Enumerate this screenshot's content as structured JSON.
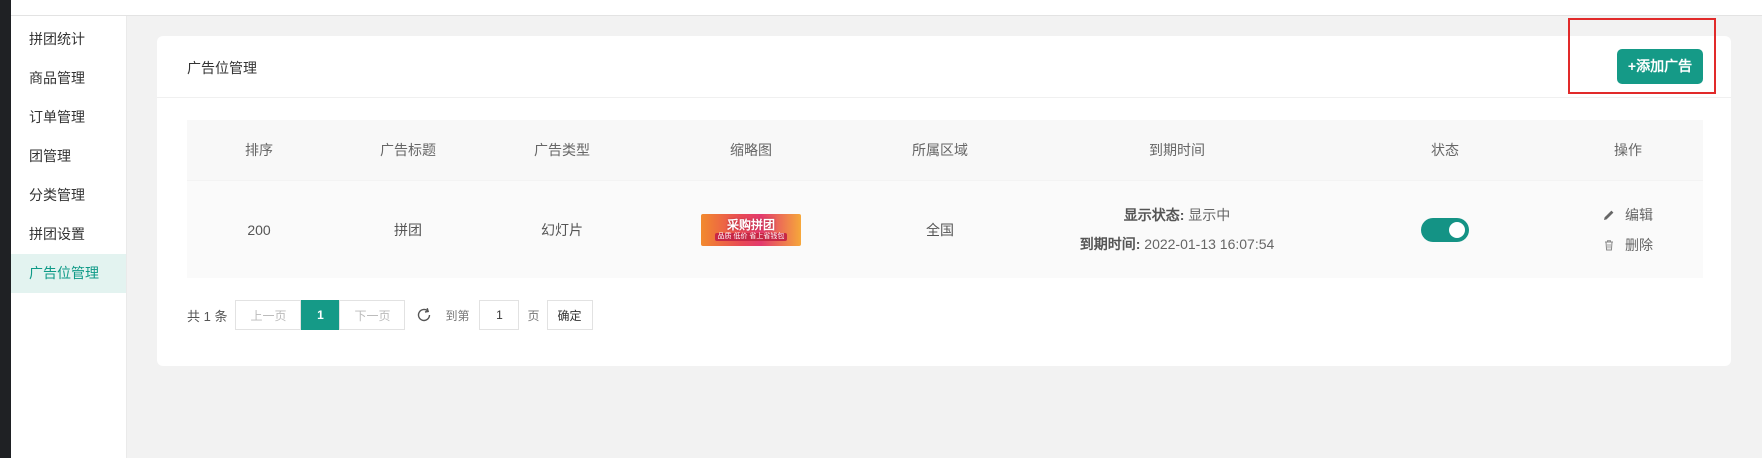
{
  "sidebar": {
    "items": [
      {
        "label": "拼团统计"
      },
      {
        "label": "商品管理"
      },
      {
        "label": "订单管理"
      },
      {
        "label": "团管理"
      },
      {
        "label": "分类管理"
      },
      {
        "label": "拼团设置"
      },
      {
        "label": "广告位管理",
        "active": true
      }
    ]
  },
  "card": {
    "title": "广告位管理",
    "add_button": "+添加广告"
  },
  "table": {
    "headers": [
      "排序",
      "广告标题",
      "广告类型",
      "缩略图",
      "所属区域",
      "到期时间",
      "状态",
      "操作"
    ],
    "rows": [
      {
        "sort": "200",
        "title": "拼团",
        "type": "幻灯片",
        "thumb_main": "采购拼团",
        "thumb_sub": "品质 低价 省上省钱包",
        "region": "全国",
        "display_label": "显示状态:",
        "display_value": "显示中",
        "expire_label": "到期时间:",
        "expire_value": "2022-01-13 16:07:54",
        "status_on": true,
        "edit_label": "编辑",
        "delete_label": "删除"
      }
    ]
  },
  "pagination": {
    "total": "共 1 条",
    "prev": "上一页",
    "current": "1",
    "next": "下一页",
    "goto_label": "到第",
    "goto_value": "1",
    "unit": "页",
    "confirm": "确定"
  },
  "colors": {
    "accent": "#159a87",
    "highlight": "#e12a2a"
  }
}
